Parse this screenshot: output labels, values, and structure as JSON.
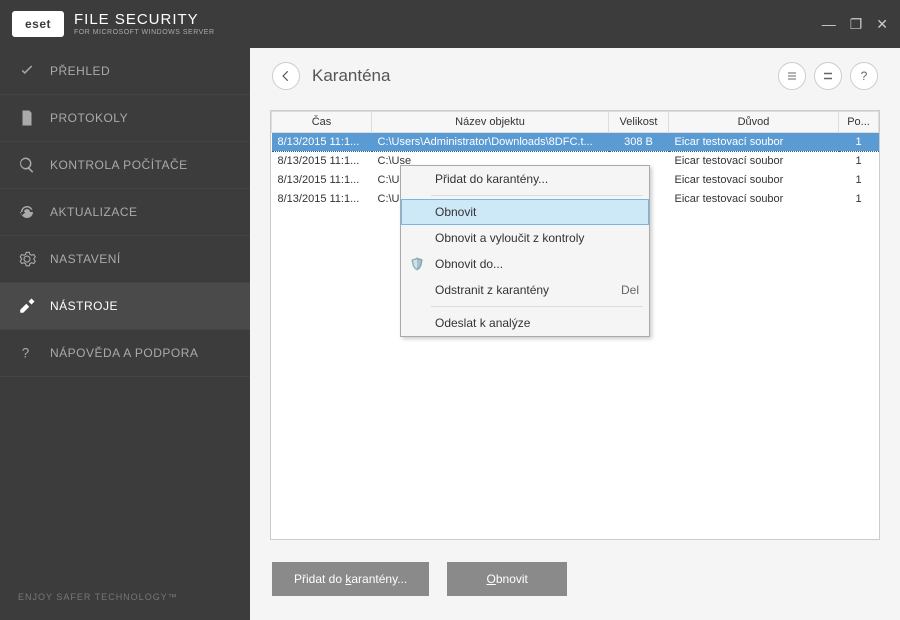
{
  "brand": {
    "logo": "eset",
    "title": "FILE SECURITY",
    "subtitle": "FOR MICROSOFT WINDOWS SERVER"
  },
  "window_controls": {
    "min": "—",
    "restore": "❐",
    "close": "✕"
  },
  "sidebar": {
    "items": [
      {
        "label": "PŘEHLED"
      },
      {
        "label": "PROTOKOLY"
      },
      {
        "label": "KONTROLA POČÍTAČE"
      },
      {
        "label": "AKTUALIZACE"
      },
      {
        "label": "NASTAVENÍ"
      },
      {
        "label": "NÁSTROJE"
      },
      {
        "label": "NÁPOVĚDA A PODPORA"
      }
    ],
    "footer": "ENJOY SAFER TECHNOLOGY™"
  },
  "page": {
    "title": "Karanténa",
    "help": "?"
  },
  "table": {
    "headers": {
      "time": "Čas",
      "object": "Název objektu",
      "size": "Velikost",
      "reason": "Důvod",
      "count": "Po..."
    },
    "rows": [
      {
        "time": "8/13/2015 11:1...",
        "object": "C:\\Users\\Administrator\\Downloads\\8DFC.t...",
        "size": "308 B",
        "reason": "Eicar testovací soubor",
        "count": "1",
        "selected": true
      },
      {
        "time": "8/13/2015 11:1...",
        "object": "C:\\Use",
        "size": "",
        "reason": "Eicar testovací soubor",
        "count": "1",
        "selected": false
      },
      {
        "time": "8/13/2015 11:1...",
        "object": "C:\\Use",
        "size": "",
        "reason": "Eicar testovací soubor",
        "count": "1",
        "selected": false
      },
      {
        "time": "8/13/2015 11:1...",
        "object": "C:\\Use",
        "size": "",
        "reason": "Eicar testovací soubor",
        "count": "1",
        "selected": false
      }
    ]
  },
  "context_menu": {
    "add": "Přidat do karantény...",
    "restore": "Obnovit",
    "restore_exclude": "Obnovit a vyloučit z kontroly",
    "restore_to": "Obnovit do...",
    "remove": "Odstranit z karantény",
    "remove_shortcut": "Del",
    "submit": "Odeslat k analýze"
  },
  "buttons": {
    "add_pre": "Přidat do ",
    "add_k": "k",
    "add_post": "arantény...",
    "restore_pre": "",
    "restore_o": "O",
    "restore_post": "bnovit"
  }
}
